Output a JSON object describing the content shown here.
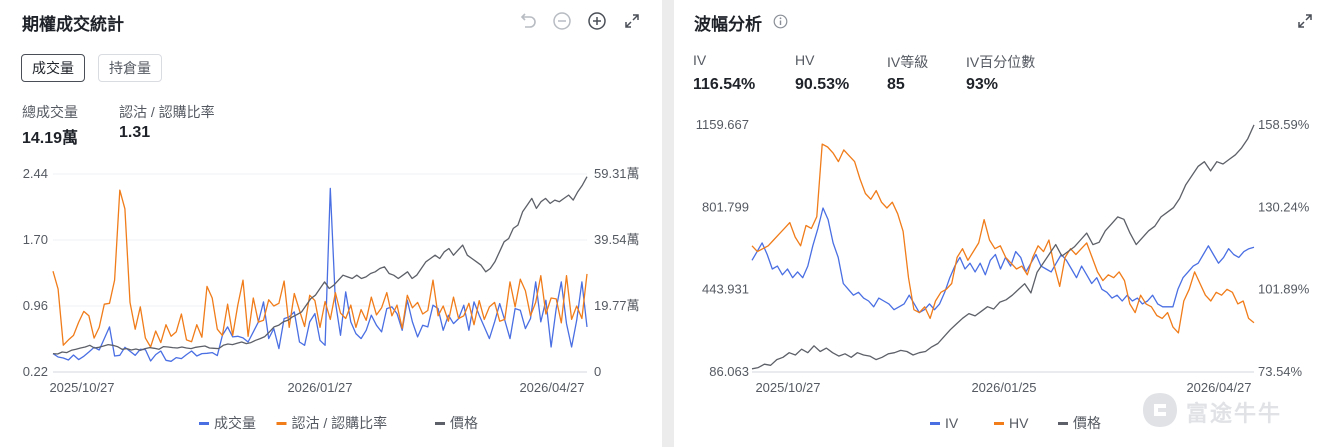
{
  "colors": {
    "blue": "#4a6fe3",
    "orange": "#f07c1a",
    "gray": "#5d6068",
    "grid": "#eef0f3"
  },
  "left_panel": {
    "title": "期權成交統計",
    "icons": [
      "undo-icon",
      "zoom-out-icon",
      "zoom-in-icon",
      "expand-icon"
    ],
    "tabs": [
      {
        "label": "成交量",
        "active": true
      },
      {
        "label": "持倉量",
        "active": false
      }
    ],
    "stats": [
      {
        "label": "總成交量",
        "value": "14.19萬"
      },
      {
        "label": "認沽 / 認購比率",
        "value": "1.31"
      }
    ]
  },
  "right_panel": {
    "title": "波幅分析",
    "icons": [
      "info-icon",
      "expand-icon"
    ],
    "stats": [
      {
        "label": "IV",
        "value": "116.54%"
      },
      {
        "label": "HV",
        "value": "90.53%"
      },
      {
        "label": "IV等級",
        "value": "85"
      },
      {
        "label": "IV百分位數",
        "value": "93%"
      }
    ]
  },
  "watermark": "富途牛牛",
  "chart_data": [
    {
      "type": "line",
      "title": "",
      "x_ticks": [
        "2025/10/27",
        "2026/01/27",
        "2026/04/27"
      ],
      "y_left_ticks": [
        "2.44",
        "1.70",
        "0.96",
        "0.22"
      ],
      "y_right_ticks": [
        "59.31萬",
        "39.54萬",
        "19.77萬",
        "0"
      ],
      "y_left_range": [
        0.22,
        2.44
      ],
      "y_right_range": [
        0,
        59.31
      ],
      "y_right_unit": "萬",
      "grid": true,
      "legend_position": "bottom",
      "series": [
        {
          "name": "成交量",
          "axis": "right",
          "color": "#4a6fe3",
          "values": [
            5.5,
            4.5,
            4.2,
            3.6,
            5.1,
            3.7,
            4.7,
            6.0,
            7.4,
            6.6,
            10.0,
            13.5,
            4.8,
            5.0,
            7.4,
            6.2,
            5.0,
            6.8,
            6.7,
            3.3,
            5.2,
            6.3,
            3.5,
            3.2,
            4.3,
            4.0,
            5.2,
            6.3,
            4.8,
            5.5,
            5.6,
            5.8,
            4.9,
            11.0,
            13.5,
            10.5,
            10.7,
            10.2,
            9.0,
            12.0,
            15.0,
            21.0,
            10.0,
            13.0,
            7.0,
            16.0,
            16.5,
            18.0,
            9.0,
            8.0,
            15.0,
            17.5,
            9.5,
            8.0,
            55.0,
            21.0,
            11.0,
            24.0,
            15.0,
            11.5,
            10.0,
            12.5,
            17.0,
            14.0,
            12.0,
            19.0,
            19.5,
            17.5,
            12.5,
            21.5,
            15.0,
            10.5,
            14.0,
            13.5,
            20.0,
            19.0,
            12.5,
            17.0,
            14.5,
            16.0,
            20.0,
            12.5,
            21.0,
            17.0,
            13.5,
            10.0,
            15.0,
            20.5,
            15.5,
            10.0,
            19.0,
            18.5,
            13.0,
            16.0,
            27.0,
            15.0,
            21.5,
            7.5,
            19.0,
            27.0,
            14.5,
            7.5,
            15.5,
            27.0,
            13.5
          ]
        },
        {
          "name": "認沽 / 認購比率",
          "axis": "left",
          "color": "#f07c1a",
          "values": [
            1.35,
            1.15,
            0.52,
            0.58,
            0.63,
            0.78,
            0.9,
            0.85,
            0.6,
            0.72,
            0.98,
            0.99,
            1.25,
            2.26,
            2.05,
            1.0,
            0.7,
            0.95,
            0.6,
            0.5,
            0.68,
            0.55,
            0.75,
            0.62,
            0.67,
            0.87,
            0.58,
            0.56,
            0.75,
            0.61,
            1.18,
            1.05,
            0.7,
            0.63,
            0.98,
            0.63,
            0.97,
            1.25,
            0.62,
            1.05,
            0.78,
            0.8,
            1.03,
            0.96,
            0.99,
            1.24,
            0.72,
            1.1,
            0.91,
            0.73,
            1.08,
            1.02,
            0.72,
            1.01,
            0.81,
            1.11,
            0.88,
            0.82,
            0.97,
            0.72,
            0.92,
            0.8,
            1.06,
            0.86,
            0.94,
            1.11,
            0.85,
            0.97,
            0.71,
            1.08,
            0.94,
            1.0,
            0.87,
            0.91,
            1.25,
            0.85,
            0.96,
            0.79,
            1.06,
            0.82,
            0.85,
            0.99,
            0.75,
            1.02,
            0.81,
            0.95,
            1.0,
            0.79,
            0.81,
            1.23,
            0.95,
            1.26,
            1.13,
            0.85,
            1.0,
            1.3,
            0.87,
            1.05,
            1.04,
            0.77,
            1.3,
            0.81,
            0.96,
            0.82,
            1.32
          ]
        },
        {
          "name": "價格",
          "axis": "right",
          "color": "#5d6068",
          "values": [
            5.5,
            5.4,
            6.0,
            5.8,
            6.5,
            6.8,
            7.2,
            7.5,
            8.0,
            7.2,
            7.4,
            7.8,
            8.2,
            8.0,
            7.6,
            6.8,
            7.0,
            6.6,
            6.9,
            6.5,
            7.0,
            7.3,
            7.1,
            6.8,
            7.6,
            7.5,
            7.3,
            7.2,
            7.5,
            7.2,
            7.0,
            7.4,
            7.6,
            7.8,
            7.2,
            7.1,
            7.0,
            8.0,
            8.4,
            8.2,
            8.6,
            9.0,
            8.5,
            8.8,
            9.5,
            10.0,
            10.6,
            12.0,
            13.5,
            14.0,
            15.0,
            15.5,
            16.5,
            17.2,
            18.0,
            20.0,
            22.0,
            23.0,
            25.0,
            27.0,
            25.0,
            26.0,
            27.5,
            29.0,
            28.5,
            28.0,
            29.0,
            28.0,
            28.5,
            29.5,
            30.0,
            31.0,
            31.5,
            29.5,
            29.0,
            28.0,
            29.0,
            30.0,
            28.0,
            29.0,
            31.0,
            33.0,
            34.0,
            35.0,
            34.0,
            36.0,
            37.0,
            35.0,
            36.5,
            38.0,
            35.0,
            34.0,
            33.0,
            32.0,
            30.0,
            31.0,
            33.0,
            36.0,
            39.0,
            40.0,
            43.0,
            44.0,
            48.0,
            50.0,
            52.0,
            49.0,
            51.0,
            52.0,
            50.5,
            51.5,
            51.0,
            52.0,
            53.0,
            51.5,
            54.0,
            56.0,
            58.5
          ]
        }
      ]
    },
    {
      "type": "line",
      "title": "",
      "x_ticks": [
        "2025/10/27",
        "2026/01/25",
        "2026/04/27"
      ],
      "y_left_ticks": [
        "1159.667",
        "801.799",
        "443.931",
        "86.063"
      ],
      "y_right_ticks": [
        "158.59%",
        "130.24%",
        "101.89%",
        "73.54%"
      ],
      "y_left_range": [
        86.063,
        1159.667
      ],
      "y_right_range": [
        73.54,
        158.59
      ],
      "grid": false,
      "legend_position": "bottom",
      "series": [
        {
          "name": "IV",
          "axis": "right",
          "color": "#4a6fe3",
          "values": [
            112.0,
            115.0,
            118.0,
            114.0,
            109.0,
            110.0,
            107.0,
            109.0,
            106.0,
            108.0,
            106.0,
            110.0,
            117.0,
            123.0,
            130.0,
            126.0,
            118.0,
            113.0,
            104.0,
            102.0,
            100.0,
            101.0,
            99.0,
            98.0,
            96.0,
            99.0,
            98.0,
            97.0,
            95.0,
            96.0,
            97.0,
            100.0,
            97.0,
            94.0,
            95.0,
            97.0,
            95.0,
            97.0,
            101.0,
            106.0,
            110.0,
            113.0,
            109.0,
            111.0,
            108.0,
            111.0,
            107.0,
            112.0,
            114.0,
            109.0,
            113.0,
            110.0,
            115.0,
            113.0,
            108.0,
            111.0,
            114.0,
            110.0,
            109.0,
            108.0,
            111.0,
            114.0,
            112.0,
            109.0,
            106.0,
            110.0,
            107.0,
            104.0,
            106.0,
            102.0,
            101.0,
            99.0,
            100.0,
            98.0,
            100.0,
            98.0,
            99.0,
            97.0,
            98.0,
            100.0,
            97.0,
            96.0,
            96.0,
            96.0,
            102.0,
            106.0,
            108.0,
            110.0,
            111.0,
            114.0,
            117.0,
            114.0,
            111.0,
            113.0,
            116.0,
            114.0,
            113.0,
            115.0,
            116.0,
            116.5
          ]
        },
        {
          "name": "HV",
          "axis": "right",
          "color": "#f07c1a",
          "values": [
            117.0,
            115.0,
            116.0,
            117.0,
            119.0,
            121.0,
            123.0,
            125.0,
            120.0,
            117.0,
            124.0,
            123.0,
            127.0,
            152.0,
            151.0,
            149.0,
            146.0,
            150.0,
            148.0,
            146.0,
            140.0,
            135.0,
            133.0,
            136.0,
            132.0,
            130.0,
            132.0,
            128.0,
            122.0,
            106.0,
            95.0,
            94.0,
            96.0,
            92.0,
            98.0,
            101.0,
            102.0,
            104.0,
            113.0,
            116.0,
            112.0,
            115.0,
            118.0,
            126.0,
            119.0,
            116.0,
            117.0,
            113.0,
            111.0,
            109.0,
            110.0,
            107.0,
            113.0,
            117.0,
            115.0,
            119.0,
            110.0,
            103.0,
            113.0,
            116.0,
            114.0,
            116.0,
            118.0,
            113.0,
            108.0,
            105.0,
            107.0,
            106.0,
            108.0,
            105.0,
            97.0,
            94.0,
            100.0,
            97.0,
            96.0,
            93.0,
            92.0,
            94.0,
            89.0,
            87.0,
            98.0,
            102.0,
            108.0,
            104.0,
            100.0,
            98.0,
            101.0,
            100.0,
            102.0,
            101.0,
            97.0,
            98.0,
            92.0,
            90.5
          ]
        },
        {
          "name": "價格",
          "axis": "left",
          "color": "#5d6068",
          "values": [
            100,
            105,
            120,
            115,
            140,
            150,
            170,
            160,
            185,
            170,
            200,
            175,
            190,
            170,
            155,
            165,
            150,
            170,
            160,
            155,
            140,
            150,
            165,
            170,
            180,
            175,
            160,
            170,
            175,
            195,
            210,
            240,
            270,
            295,
            320,
            340,
            330,
            350,
            370,
            360,
            390,
            400,
            420,
            445,
            470,
            430,
            520,
            560,
            600,
            640,
            590,
            610,
            630,
            660,
            690,
            640,
            650,
            700,
            730,
            760,
            750,
            690,
            640,
            670,
            700,
            720,
            760,
            780,
            800,
            840,
            900,
            940,
            980,
            1000,
            960,
            1000,
            990,
            1010,
            1030,
            1060,
            1100,
            1160
          ]
        }
      ]
    }
  ]
}
